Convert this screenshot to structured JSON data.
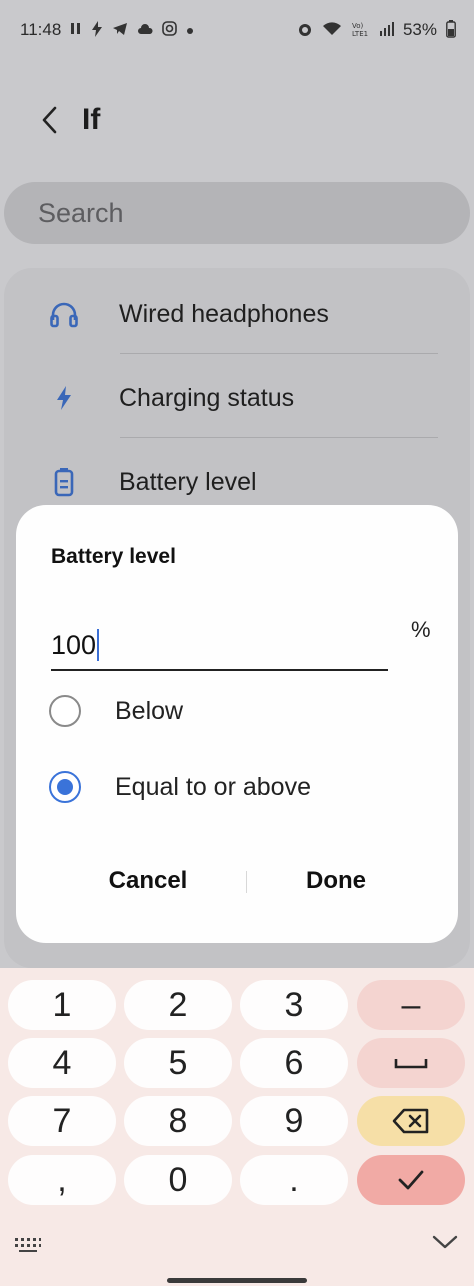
{
  "status_bar": {
    "time": "11:48",
    "battery": "53%"
  },
  "header": {
    "title": "If"
  },
  "search": {
    "placeholder": "Search"
  },
  "list": {
    "items": [
      {
        "label": "Wired headphones",
        "icon": "headphones-icon"
      },
      {
        "label": "Charging status",
        "icon": "lightning-icon"
      },
      {
        "label": "Battery level",
        "icon": "battery-icon"
      }
    ]
  },
  "dialog": {
    "title": "Battery level",
    "value": "100",
    "unit": "%",
    "options": [
      {
        "label": "Below",
        "selected": false
      },
      {
        "label": "Equal to or above",
        "selected": true
      }
    ],
    "cancel_label": "Cancel",
    "done_label": "Done"
  },
  "keyboard": {
    "rows": [
      [
        "1",
        "2",
        "3",
        "–"
      ],
      [
        "4",
        "5",
        "6",
        "space"
      ],
      [
        "7",
        "8",
        "9",
        "backspace"
      ],
      [
        ",",
        "0",
        ".",
        "enter"
      ]
    ]
  },
  "colors": {
    "accent": "#3a73d9",
    "keyboard_bg": "#f7e9e6",
    "enter_key": "#f1aaa5",
    "backspace_key": "#f6dfa7"
  }
}
